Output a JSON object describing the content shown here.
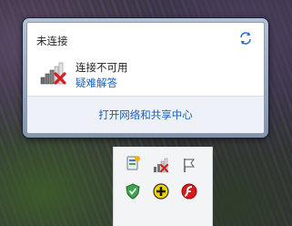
{
  "popup": {
    "header": "未连接",
    "status_text": "连接不可用",
    "troubleshoot_link": "疑难解答",
    "footer_link": "打开网络和共享中心"
  },
  "tray": {
    "icons": [
      "action-center-icon",
      "network-disconnected-icon",
      "flag-icon",
      "security-shield-icon",
      "add-plus-icon",
      "flash-player-icon"
    ]
  },
  "colors": {
    "link": "#1a5fb4",
    "error_red": "#d42020",
    "footer_bg": "#eef2f8"
  }
}
